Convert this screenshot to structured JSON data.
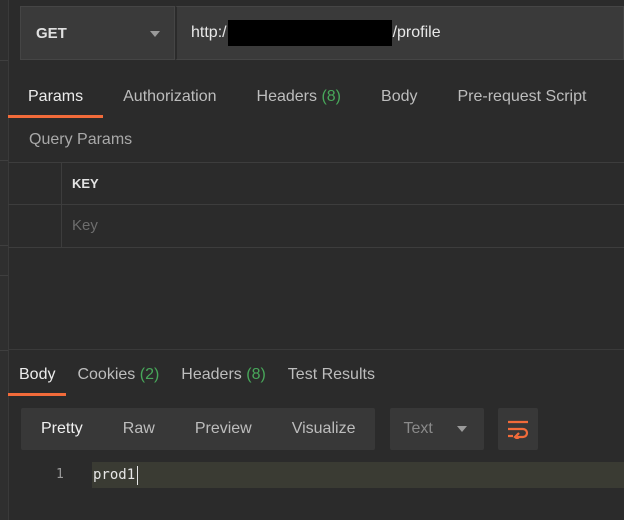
{
  "request": {
    "method": "GET",
    "url_prefix": "http:/",
    "url_suffix": "/profile"
  },
  "request_tabs": [
    {
      "label": "Params"
    },
    {
      "label": "Authorization"
    },
    {
      "label": "Headers",
      "count": "(8)"
    },
    {
      "label": "Body"
    },
    {
      "label": "Pre-request Script"
    }
  ],
  "params": {
    "section_label": "Query Params",
    "column_header": "KEY",
    "key_placeholder": "Key"
  },
  "response_tabs": [
    {
      "label": "Body"
    },
    {
      "label": "Cookies",
      "count": "(2)"
    },
    {
      "label": "Headers",
      "count": "(8)"
    },
    {
      "label": "Test Results"
    }
  ],
  "response_toolbar": {
    "views": [
      "Pretty",
      "Raw",
      "Preview",
      "Visualize"
    ],
    "format": "Text"
  },
  "response_body": {
    "line_number": "1",
    "text": "prod1"
  },
  "colors": {
    "accent": "#f26b3a",
    "count_green": "#48a75a",
    "background": "#2b2b2b"
  },
  "icons": [
    "chevron-down-icon",
    "wrap-lines-icon"
  ]
}
